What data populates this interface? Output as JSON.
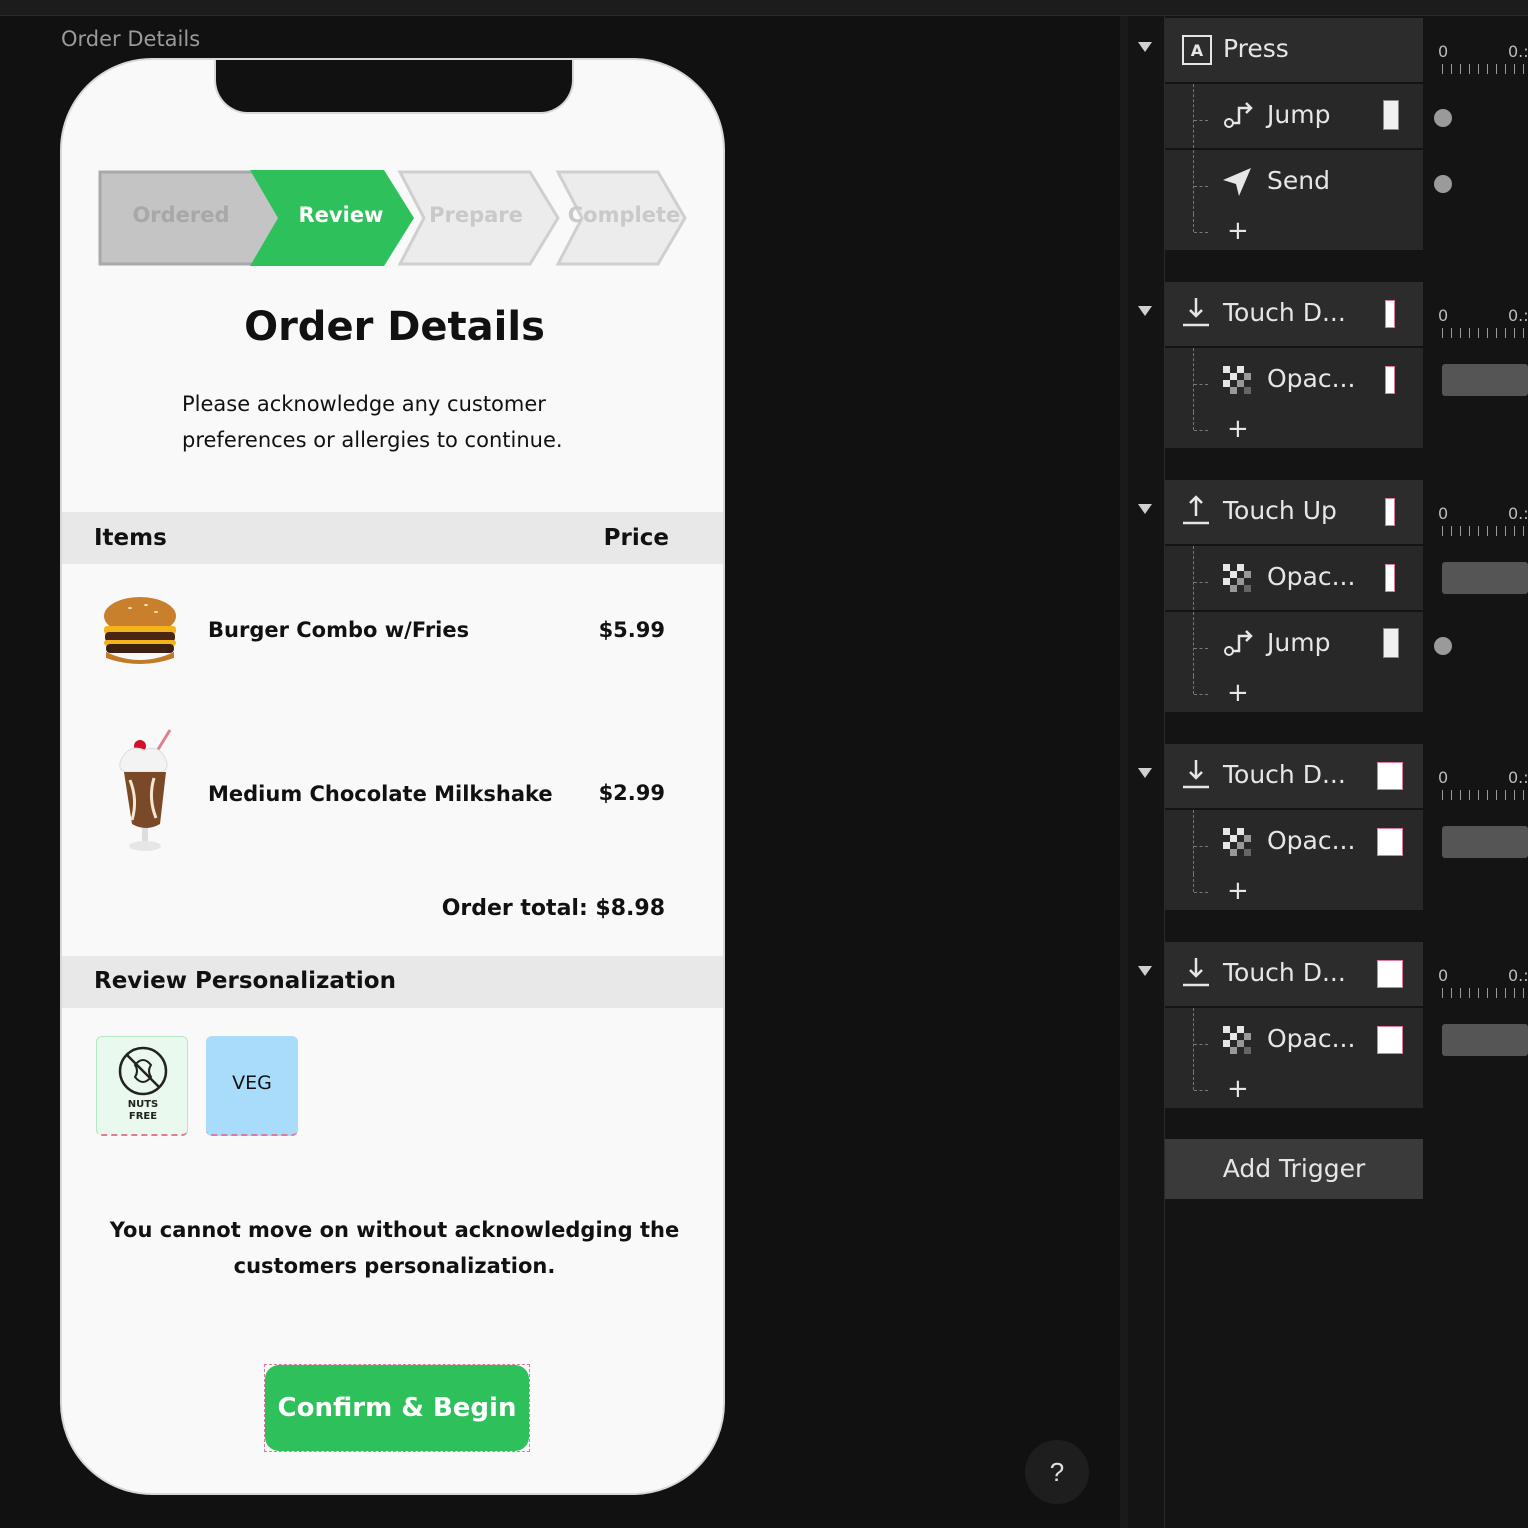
{
  "canvas": {
    "frame_title": "Order Details"
  },
  "progress": {
    "steps": [
      "Ordered",
      "Review",
      "Prepare",
      "Complete"
    ],
    "active": "Review"
  },
  "page": {
    "title": "Order Details",
    "subtitle": "Please acknowledge  any customer preferences or allergies to continue.",
    "items_header": "Items",
    "price_header": "Price",
    "items": [
      {
        "name": "Burger Combo w/Fries",
        "price": "$5.99"
      },
      {
        "name": "Medium Chocolate Milkshake",
        "price": "$2.99"
      }
    ],
    "order_total": "Order total: $8.98",
    "review_header": "Review Personalization",
    "tags": {
      "nuts_line1": "NUTS",
      "nuts_line2": "FREE",
      "veg": "VEG"
    },
    "warning": "You cannot move on without acknowledging the customers personalization.",
    "confirm_label": "Confirm & Begin"
  },
  "help_label": "?",
  "panel": {
    "triggers": [
      {
        "label": "Press",
        "actions": [
          "Jump",
          "Send"
        ]
      },
      {
        "label": "Touch D...",
        "actions": [
          "Opac..."
        ]
      },
      {
        "label": "Touch Up",
        "actions": [
          "Opac...",
          "Jump"
        ]
      },
      {
        "label": "Touch D...",
        "actions": [
          "Opac..."
        ]
      },
      {
        "label": "Touch D...",
        "actions": [
          "Opac..."
        ]
      }
    ],
    "add_symbol": "+",
    "timeline_zero": "0",
    "timeline_tick": "0.:",
    "add_trigger_label": "Add Trigger"
  },
  "colors": {
    "accent_green": "#2ec15b",
    "veg_blue": "#a9dcfb",
    "panel_row": "#282828"
  }
}
